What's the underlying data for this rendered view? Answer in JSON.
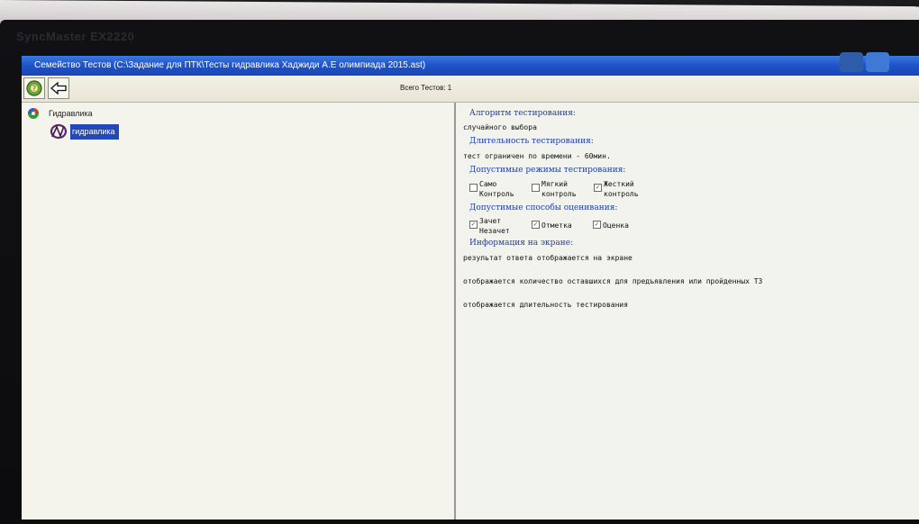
{
  "monitor": {
    "brand": "SyncMaster EX2220"
  },
  "window": {
    "title": "Семейство Тестов (С:\\Задание для ПТК\\Тесты гидравлика Хаджиди А.Е олимпиада 2015.ast)"
  },
  "toolbar": {
    "total_tests": "Всего Тестов: 1"
  },
  "tree": {
    "root_label": "Гидравлика",
    "child_label": "гидравлика"
  },
  "details": {
    "algo_heading": "Алгоритм тестирования:",
    "algo_value": "случайного выбора",
    "duration_heading": "Длительность тестирования:",
    "duration_value": "тест ограничен по времени - 60мин.",
    "modes_heading": "Допустимые режимы тестирования:",
    "modes": [
      {
        "label": "Само\nКонтроль",
        "checked": false
      },
      {
        "label": "Мягкий\nконтроль",
        "checked": false
      },
      {
        "label": "Жесткий\nконтроль",
        "checked": true
      }
    ],
    "grading_heading": "Допустимые способы оценивания:",
    "grading": [
      {
        "label": "Зачет\nНезачет",
        "checked": true
      },
      {
        "label": "Отметка",
        "checked": true
      },
      {
        "label": "Оценка",
        "checked": true
      }
    ],
    "screen_info_heading": "Информация на экране:",
    "screen_info": [
      "результат ответа отображается на экране",
      "отображается количество оставшихся для предъявления или пройденных ТЗ",
      "отображается длительность тестирования"
    ]
  },
  "colors": {
    "titlebar": "#1e52c8",
    "heading": "#1f3fa8",
    "selection": "#2448b8"
  }
}
